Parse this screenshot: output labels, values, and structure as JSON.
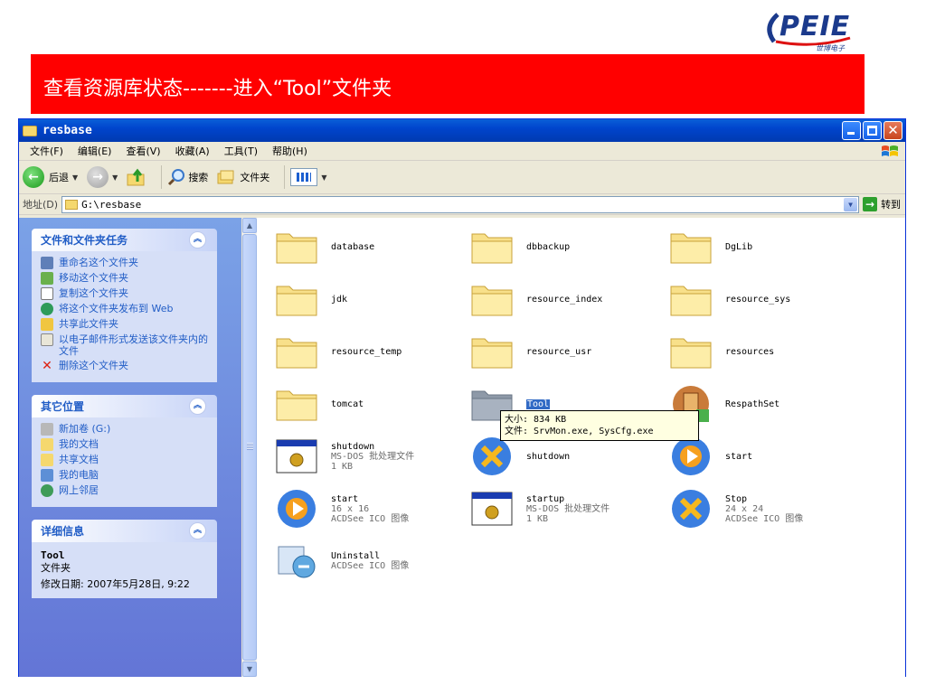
{
  "logo": {
    "text": "PEIE",
    "subtitle": "世博电子"
  },
  "banner": {
    "title": "查看资源库状态-------进入“Tool”文件夹"
  },
  "window": {
    "title": "resbase",
    "menu": [
      "文件(F)",
      "编辑(E)",
      "查看(V)",
      "收藏(A)",
      "工具(T)",
      "帮助(H)"
    ],
    "toolbar": {
      "back": "后退",
      "search": "搜索",
      "folders": "文件夹"
    },
    "address": {
      "label": "地址(D)",
      "path": "G:\\resbase",
      "go": "转到"
    }
  },
  "sidebar": {
    "tasks": {
      "title": "文件和文件夹任务",
      "items": [
        "重命名这个文件夹",
        "移动这个文件夹",
        "复制这个文件夹",
        "将这个文件夹发布到 Web",
        "共享此文件夹",
        "以电子邮件形式发送该文件夹内的文件",
        "删除这个文件夹"
      ]
    },
    "places": {
      "title": "其它位置",
      "items": [
        "新加卷 (G:)",
        "我的文档",
        "共享文档",
        "我的电脑",
        "网上邻居"
      ]
    },
    "details": {
      "title": "详细信息",
      "name": "Tool",
      "type": "文件夹",
      "modified": "修改日期: 2007年5月28日, 9:22"
    }
  },
  "files": [
    {
      "name": "database",
      "sub1": "",
      "sub2": ""
    },
    {
      "name": "dbbackup",
      "sub1": "",
      "sub2": ""
    },
    {
      "name": "DgLib",
      "sub1": "",
      "sub2": ""
    },
    {
      "name": "jdk",
      "sub1": "",
      "sub2": ""
    },
    {
      "name": "resource_index",
      "sub1": "",
      "sub2": ""
    },
    {
      "name": "resource_sys",
      "sub1": "",
      "sub2": ""
    },
    {
      "name": "resource_temp",
      "sub1": "",
      "sub2": ""
    },
    {
      "name": "resource_usr",
      "sub1": "",
      "sub2": ""
    },
    {
      "name": "resources",
      "sub1": "",
      "sub2": ""
    },
    {
      "name": "tomcat",
      "sub1": "",
      "sub2": ""
    },
    {
      "name": "Tool",
      "sub1": "",
      "sub2": ""
    },
    {
      "name": "RespathSet",
      "sub1": "",
      "sub2": ""
    },
    {
      "name": "shutdown",
      "sub1": "MS-DOS 批处理文件",
      "sub2": "1 KB"
    },
    {
      "name": "shutdown",
      "sub1": "",
      "sub2": ""
    },
    {
      "name": "start",
      "sub1": "",
      "sub2": ""
    },
    {
      "name": "start",
      "sub1": "16 x 16",
      "sub2": "ACDSee ICO 图像"
    },
    {
      "name": "startup",
      "sub1": "MS-DOS 批处理文件",
      "sub2": "1 KB"
    },
    {
      "name": "Stop",
      "sub1": "24 x 24",
      "sub2": "ACDSee ICO 图像"
    },
    {
      "name": "Uninstall",
      "sub1": "ACDSee ICO 图像",
      "sub2": ""
    }
  ],
  "tooltip": {
    "size": "大小: 834 KB",
    "files": "文件: SrvMon.exe, SysCfg.exe"
  }
}
